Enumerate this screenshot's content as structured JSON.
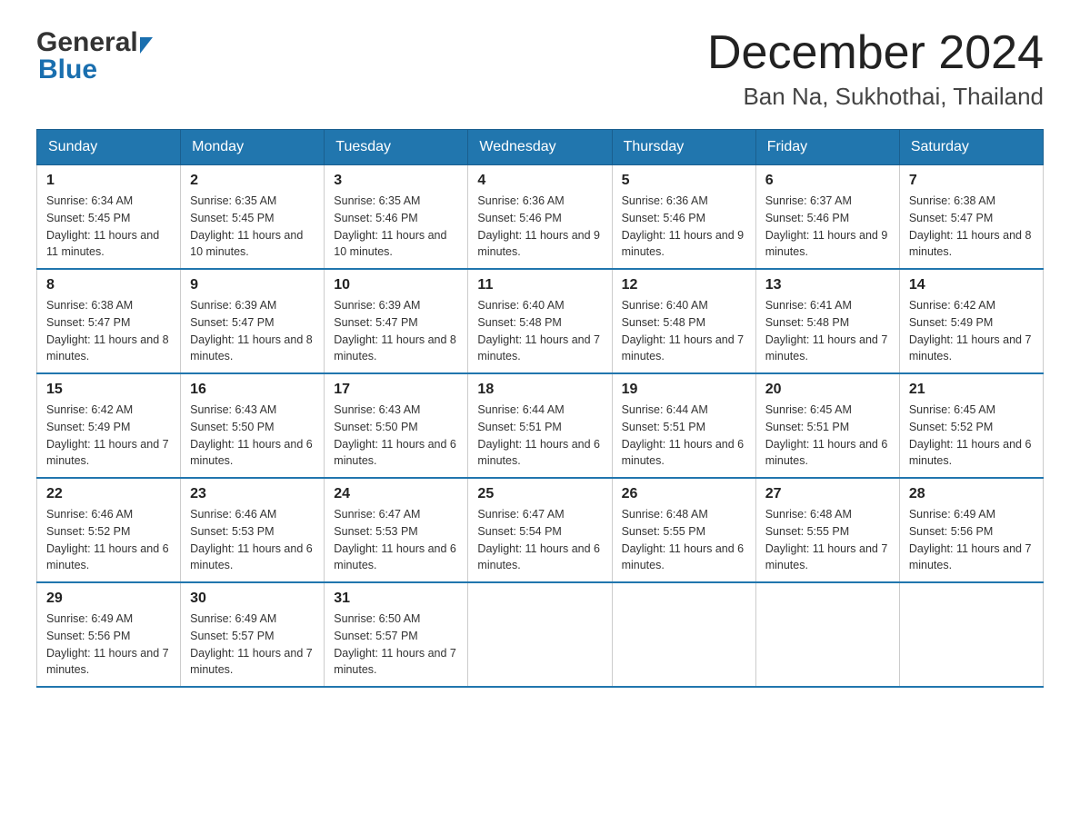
{
  "header": {
    "logo_general": "General",
    "logo_blue": "Blue",
    "month_title": "December 2024",
    "location": "Ban Na, Sukhothai, Thailand"
  },
  "days_of_week": [
    "Sunday",
    "Monday",
    "Tuesday",
    "Wednesday",
    "Thursday",
    "Friday",
    "Saturday"
  ],
  "weeks": [
    [
      {
        "day": "1",
        "sunrise": "6:34 AM",
        "sunset": "5:45 PM",
        "daylight": "11 hours and 11 minutes."
      },
      {
        "day": "2",
        "sunrise": "6:35 AM",
        "sunset": "5:45 PM",
        "daylight": "11 hours and 10 minutes."
      },
      {
        "day": "3",
        "sunrise": "6:35 AM",
        "sunset": "5:46 PM",
        "daylight": "11 hours and 10 minutes."
      },
      {
        "day": "4",
        "sunrise": "6:36 AM",
        "sunset": "5:46 PM",
        "daylight": "11 hours and 9 minutes."
      },
      {
        "day": "5",
        "sunrise": "6:36 AM",
        "sunset": "5:46 PM",
        "daylight": "11 hours and 9 minutes."
      },
      {
        "day": "6",
        "sunrise": "6:37 AM",
        "sunset": "5:46 PM",
        "daylight": "11 hours and 9 minutes."
      },
      {
        "day": "7",
        "sunrise": "6:38 AM",
        "sunset": "5:47 PM",
        "daylight": "11 hours and 8 minutes."
      }
    ],
    [
      {
        "day": "8",
        "sunrise": "6:38 AM",
        "sunset": "5:47 PM",
        "daylight": "11 hours and 8 minutes."
      },
      {
        "day": "9",
        "sunrise": "6:39 AM",
        "sunset": "5:47 PM",
        "daylight": "11 hours and 8 minutes."
      },
      {
        "day": "10",
        "sunrise": "6:39 AM",
        "sunset": "5:47 PM",
        "daylight": "11 hours and 8 minutes."
      },
      {
        "day": "11",
        "sunrise": "6:40 AM",
        "sunset": "5:48 PM",
        "daylight": "11 hours and 7 minutes."
      },
      {
        "day": "12",
        "sunrise": "6:40 AM",
        "sunset": "5:48 PM",
        "daylight": "11 hours and 7 minutes."
      },
      {
        "day": "13",
        "sunrise": "6:41 AM",
        "sunset": "5:48 PM",
        "daylight": "11 hours and 7 minutes."
      },
      {
        "day": "14",
        "sunrise": "6:42 AM",
        "sunset": "5:49 PM",
        "daylight": "11 hours and 7 minutes."
      }
    ],
    [
      {
        "day": "15",
        "sunrise": "6:42 AM",
        "sunset": "5:49 PM",
        "daylight": "11 hours and 7 minutes."
      },
      {
        "day": "16",
        "sunrise": "6:43 AM",
        "sunset": "5:50 PM",
        "daylight": "11 hours and 6 minutes."
      },
      {
        "day": "17",
        "sunrise": "6:43 AM",
        "sunset": "5:50 PM",
        "daylight": "11 hours and 6 minutes."
      },
      {
        "day": "18",
        "sunrise": "6:44 AM",
        "sunset": "5:51 PM",
        "daylight": "11 hours and 6 minutes."
      },
      {
        "day": "19",
        "sunrise": "6:44 AM",
        "sunset": "5:51 PM",
        "daylight": "11 hours and 6 minutes."
      },
      {
        "day": "20",
        "sunrise": "6:45 AM",
        "sunset": "5:51 PM",
        "daylight": "11 hours and 6 minutes."
      },
      {
        "day": "21",
        "sunrise": "6:45 AM",
        "sunset": "5:52 PM",
        "daylight": "11 hours and 6 minutes."
      }
    ],
    [
      {
        "day": "22",
        "sunrise": "6:46 AM",
        "sunset": "5:52 PM",
        "daylight": "11 hours and 6 minutes."
      },
      {
        "day": "23",
        "sunrise": "6:46 AM",
        "sunset": "5:53 PM",
        "daylight": "11 hours and 6 minutes."
      },
      {
        "day": "24",
        "sunrise": "6:47 AM",
        "sunset": "5:53 PM",
        "daylight": "11 hours and 6 minutes."
      },
      {
        "day": "25",
        "sunrise": "6:47 AM",
        "sunset": "5:54 PM",
        "daylight": "11 hours and 6 minutes."
      },
      {
        "day": "26",
        "sunrise": "6:48 AM",
        "sunset": "5:55 PM",
        "daylight": "11 hours and 6 minutes."
      },
      {
        "day": "27",
        "sunrise": "6:48 AM",
        "sunset": "5:55 PM",
        "daylight": "11 hours and 7 minutes."
      },
      {
        "day": "28",
        "sunrise": "6:49 AM",
        "sunset": "5:56 PM",
        "daylight": "11 hours and 7 minutes."
      }
    ],
    [
      {
        "day": "29",
        "sunrise": "6:49 AM",
        "sunset": "5:56 PM",
        "daylight": "11 hours and 7 minutes."
      },
      {
        "day": "30",
        "sunrise": "6:49 AM",
        "sunset": "5:57 PM",
        "daylight": "11 hours and 7 minutes."
      },
      {
        "day": "31",
        "sunrise": "6:50 AM",
        "sunset": "5:57 PM",
        "daylight": "11 hours and 7 minutes."
      },
      null,
      null,
      null,
      null
    ]
  ],
  "labels": {
    "sunrise_prefix": "Sunrise: ",
    "sunset_prefix": "Sunset: ",
    "daylight_prefix": "Daylight: "
  }
}
